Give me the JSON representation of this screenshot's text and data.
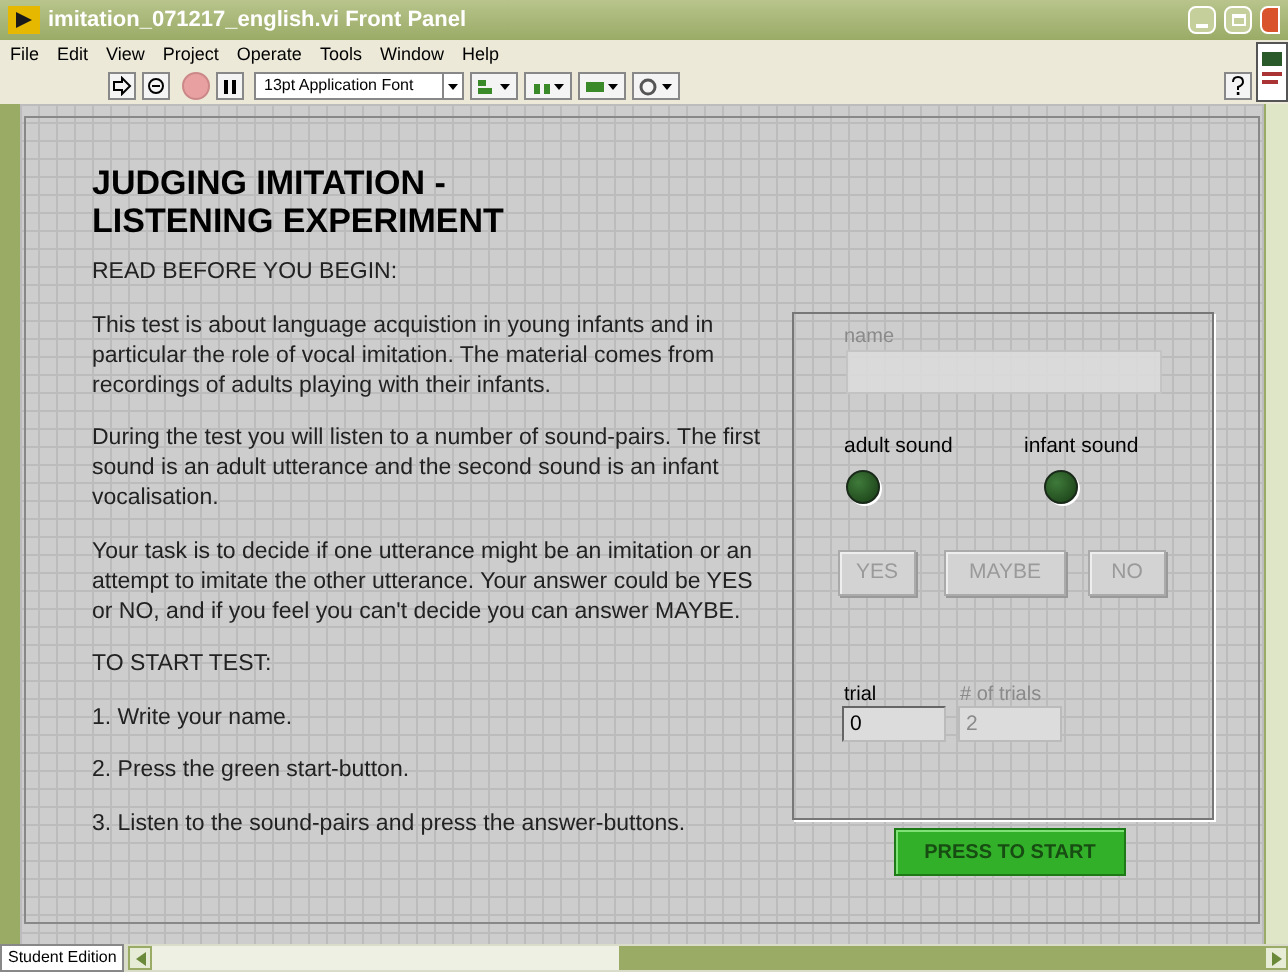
{
  "window": {
    "title": "imitation_071217_english.vi Front Panel"
  },
  "menu": [
    "File",
    "Edit",
    "View",
    "Project",
    "Operate",
    "Tools",
    "Window",
    "Help"
  ],
  "toolbar": {
    "font": "13pt Application Font",
    "running": false
  },
  "heading": "JUDGING IMITATION - LISTENING EXPERIMENT",
  "paragraphs": [
    "READ BEFORE YOU BEGIN:",
    "This test is about language acquistion in young infants and in particular the role of vocal imitation. The material comes from recordings of adults playing with their infants.",
    "During the test you will listen to a number of sound-pairs. The first sound is an adult utterance and the second sound is an infant vocalisation.",
    "Your task is to decide if one utterance might be an imitation or an attempt to imitate the other utterance. Your answer could be YES or NO, and if you feel you can't decide you can answer MAYBE.",
    "TO START TEST:",
    "1. Write your name.",
    "2. Press the green start-button.",
    "3. Listen to the sound-pairs and press the answer-buttons."
  ],
  "name_field": {
    "label": "name",
    "disabled": true
  },
  "leds": [
    {
      "label": "adult sound",
      "on": false
    },
    {
      "label": "infant sound",
      "on": false
    }
  ],
  "answer_buttons": [
    {
      "label": "YES",
      "disabled": true
    },
    {
      "label": "MAYBE",
      "disabled": true
    },
    {
      "label": "NO",
      "disabled": true
    }
  ],
  "counters": [
    {
      "label": "trial",
      "value": "0",
      "disabled": false
    },
    {
      "label": "# of trials",
      "value": "2",
      "disabled": true
    }
  ],
  "start_button": {
    "label": "PRESS TO START"
  },
  "status_bar": {
    "tab": "Student Edition"
  }
}
